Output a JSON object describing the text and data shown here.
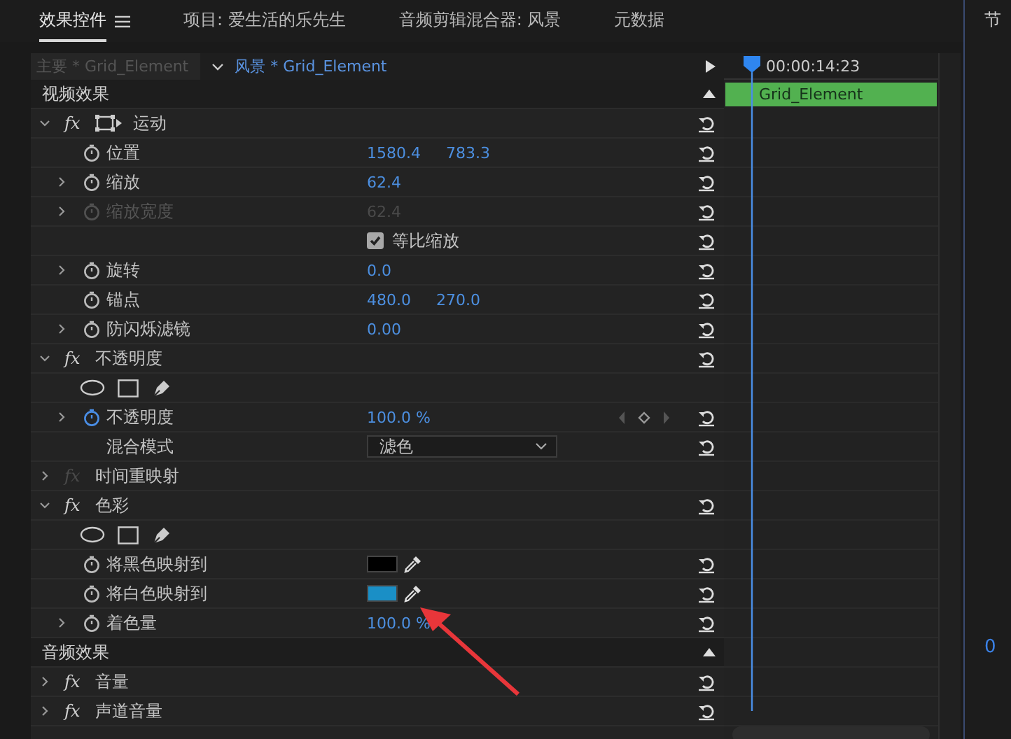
{
  "tabs": [
    {
      "label": "效果控件",
      "selected": true,
      "menu": true
    },
    {
      "label": "项目: 爱生活的乐先生",
      "selected": false
    },
    {
      "label": "音频剪辑混合器: 风景",
      "selected": false
    },
    {
      "label": "元数据",
      "selected": false
    }
  ],
  "source": {
    "master": "主要 * Grid_Element",
    "sequence": "风景 * Grid_Element"
  },
  "rows": [
    {
      "kind": "section",
      "label": "视频效果"
    },
    {
      "kind": "effect",
      "fx": "fx",
      "label": "运动",
      "expanded": true,
      "fx_enabled": true,
      "transform_icon": true,
      "reset": true
    },
    {
      "kind": "property",
      "label": "位置",
      "animated": false,
      "disabled": false,
      "values": [
        "1580.4",
        "783.3"
      ],
      "reset": true
    },
    {
      "kind": "property",
      "label": "缩放",
      "expanded": false,
      "animated": false,
      "disabled": false,
      "values": [
        "62.4"
      ],
      "reset": true
    },
    {
      "kind": "property",
      "label": "缩放宽度",
      "expanded": false,
      "animated": false,
      "disabled": true,
      "values": [
        "62.4"
      ],
      "reset": true
    },
    {
      "kind": "checkbox",
      "label": "等比缩放",
      "checked": true,
      "reset": true
    },
    {
      "kind": "property",
      "label": "旋转",
      "expanded": false,
      "animated": false,
      "disabled": false,
      "values": [
        "0.0"
      ],
      "reset": true
    },
    {
      "kind": "property",
      "label": "锚点",
      "animated": false,
      "disabled": false,
      "values": [
        "480.0",
        "270.0"
      ],
      "reset": true
    },
    {
      "kind": "property",
      "label": "防闪烁滤镜",
      "expanded": false,
      "animated": false,
      "disabled": false,
      "values": [
        "0.00"
      ],
      "reset": true
    },
    {
      "kind": "effect",
      "fx": "fx",
      "label": "不透明度",
      "expanded": true,
      "fx_enabled": true,
      "reset": true
    },
    {
      "kind": "mask-tools"
    },
    {
      "kind": "property",
      "label": "不透明度",
      "expanded": false,
      "animated": true,
      "disabled": false,
      "values": [
        "100.0 %"
      ],
      "keyframe_nav": true,
      "reset": true
    },
    {
      "kind": "dropdown",
      "label": "混合模式",
      "value": "滤色",
      "reset": true
    },
    {
      "kind": "effect",
      "fx": "fx",
      "label": "时间重映射",
      "expanded": false,
      "fx_enabled": false
    },
    {
      "kind": "effect",
      "fx": "fx",
      "label": "色彩",
      "expanded": true,
      "fx_enabled": true,
      "reset": true
    },
    {
      "kind": "mask-tools"
    },
    {
      "kind": "color",
      "label": "将黑色映射到",
      "color": "#000000",
      "reset": true
    },
    {
      "kind": "color",
      "label": "将白色映射到",
      "color": "#1a8fc6",
      "reset": true
    },
    {
      "kind": "property",
      "label": "着色量",
      "expanded": false,
      "animated": false,
      "disabled": false,
      "values": [
        "100.0 %"
      ],
      "reset": true
    },
    {
      "kind": "section",
      "label": "音频效果"
    },
    {
      "kind": "effect",
      "fx": "fx",
      "label": "音量",
      "expanded": false,
      "fx_enabled": true,
      "reset": true
    },
    {
      "kind": "effect",
      "fx": "fx",
      "label": "声道音量",
      "expanded": false,
      "fx_enabled": true,
      "reset": true
    }
  ],
  "timeline": {
    "timecode": "00:00:14:23",
    "clip": "Grid_Element"
  },
  "program": {
    "title": "节",
    "timecode": "0"
  }
}
